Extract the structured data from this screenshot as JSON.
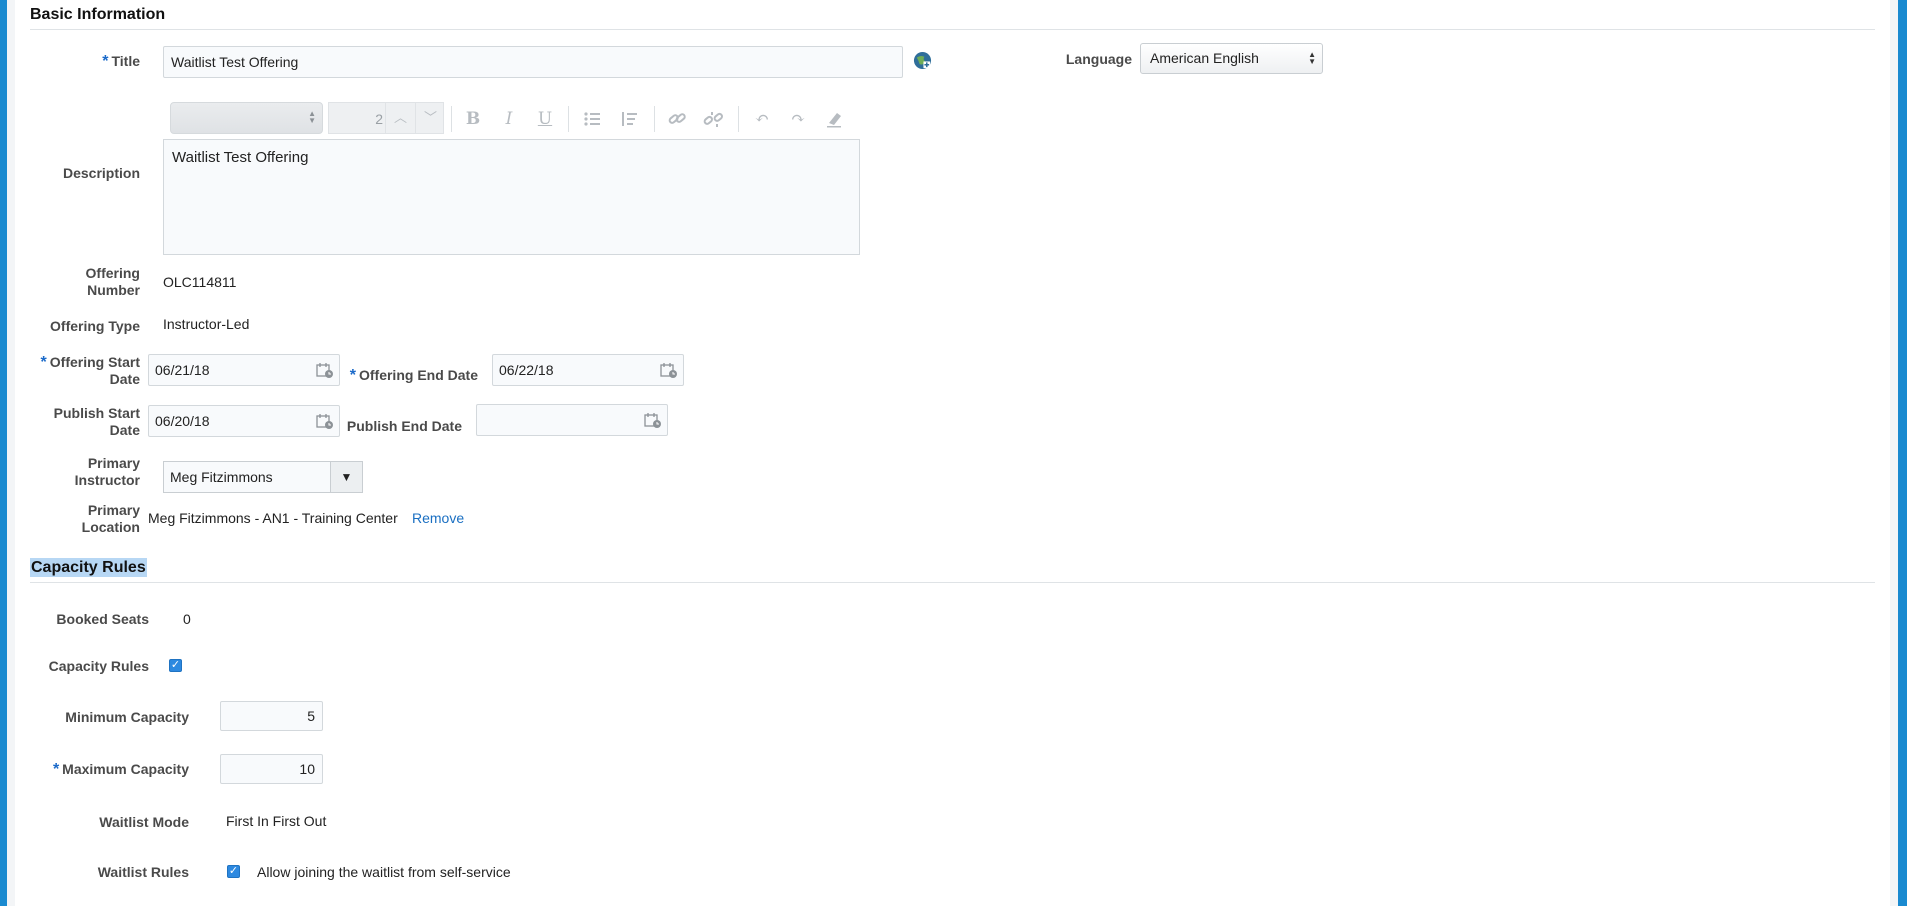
{
  "basic_info": {
    "section_title": "Basic Information",
    "title_label": "Title",
    "title_value": "Waitlist Test Offering",
    "language_label": "Language",
    "language_value": "American English",
    "description_label": "Description",
    "description_value": "Waitlist Test Offering",
    "editor": {
      "font_size_value": "2",
      "buttons": [
        "bold-icon",
        "italic-icon",
        "underline-icon",
        "bulleted-list-icon",
        "numbered-list-icon",
        "link-icon",
        "unlink-icon",
        "undo-icon",
        "redo-icon",
        "clear-format-icon"
      ]
    },
    "offering_number_label_1": "Offering",
    "offering_number_label_2": "Number",
    "offering_number_value": "OLC114811",
    "offering_type_label": "Offering Type",
    "offering_type_value": "Instructor-Led",
    "start_date_label_1": "Offering Start",
    "start_date_label_2": "Date",
    "start_date_value": "06/21/18",
    "end_date_label": "Offering End Date",
    "end_date_value": "06/22/18",
    "publish_start_label_1": "Publish Start",
    "publish_start_label_2": "Date",
    "publish_start_value": "06/20/18",
    "publish_end_label": "Publish End Date",
    "publish_end_value": "",
    "primary_instructor_label_1": "Primary",
    "primary_instructor_label_2": "Instructor",
    "primary_instructor_value": "Meg Fitzimmons",
    "primary_location_label_1": "Primary",
    "primary_location_label_2": "Location",
    "primary_location_value": "Meg Fitzimmons - AN1 - Training Center",
    "remove_link": "Remove"
  },
  "capacity": {
    "section_title": "Capacity Rules",
    "booked_seats_label": "Booked Seats",
    "booked_seats_value": "0",
    "capacity_rules_label": "Capacity Rules",
    "capacity_rules_checked": true,
    "min_capacity_label": "Minimum Capacity",
    "min_capacity_value": "5",
    "max_capacity_label": "Maximum Capacity",
    "max_capacity_value": "10",
    "waitlist_mode_label": "Waitlist Mode",
    "waitlist_mode_value": "First In First Out",
    "waitlist_rules_label": "Waitlist Rules",
    "waitlist_rules_option": "Allow joining the waitlist from self-service",
    "waitlist_rules_checked": true
  },
  "required_marker": "*",
  "colors": {
    "accent": "#1a8ad0",
    "link": "#1a6fc2",
    "required": "#1b6ac9",
    "selection": "#b7d7f4"
  }
}
